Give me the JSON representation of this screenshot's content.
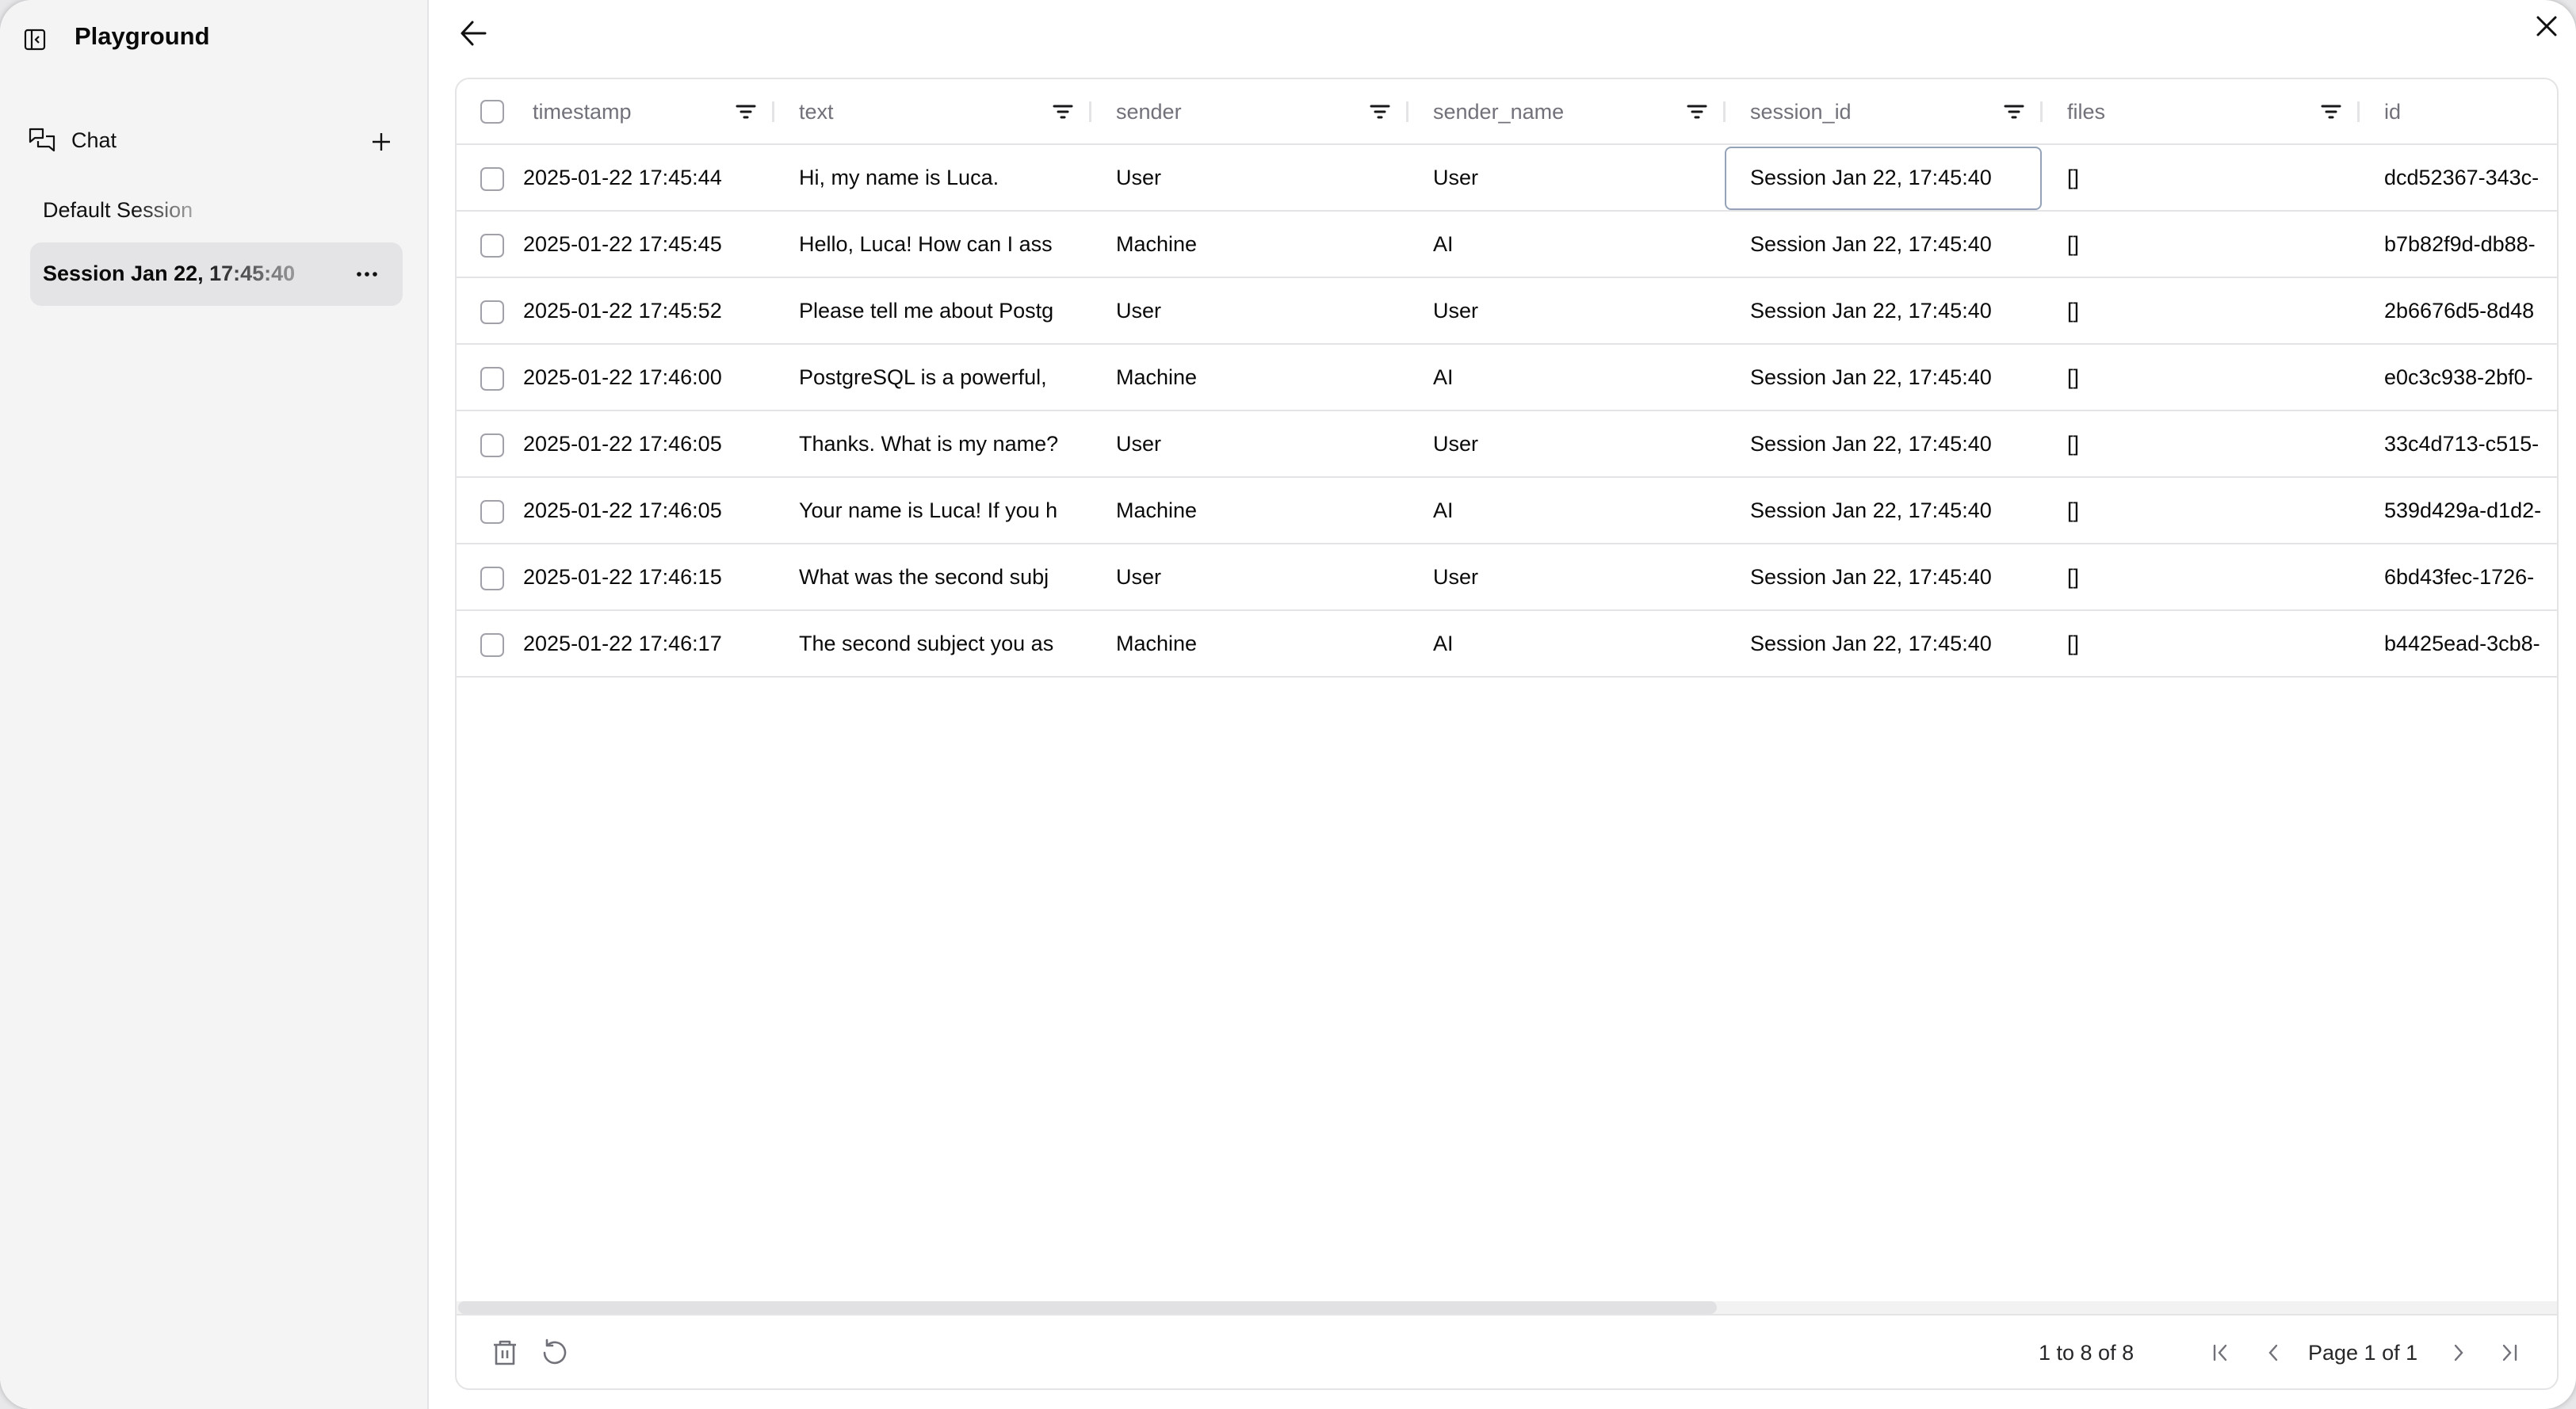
{
  "sidebar": {
    "title": "Playground",
    "section": {
      "label": "Chat"
    },
    "sessions": [
      {
        "label": "Default Session",
        "active": false
      },
      {
        "label": "Session Jan 22, 17:45:40",
        "active": true
      }
    ]
  },
  "table": {
    "columns": [
      {
        "key": "timestamp",
        "label": "timestamp"
      },
      {
        "key": "text",
        "label": "text"
      },
      {
        "key": "sender",
        "label": "sender"
      },
      {
        "key": "sender_name",
        "label": "sender_name"
      },
      {
        "key": "session_id",
        "label": "session_id"
      },
      {
        "key": "files",
        "label": "files"
      },
      {
        "key": "id",
        "label": "id"
      }
    ],
    "rows": [
      {
        "timestamp": "2025-01-22 17:45:44",
        "text": "Hi, my name is Luca.",
        "sender": "User",
        "sender_name": "User",
        "session_id": "Session Jan 22, 17:45:40",
        "files": "[]",
        "id": "dcd52367-343c-"
      },
      {
        "timestamp": "2025-01-22 17:45:45",
        "text": "Hello, Luca! How can I ass",
        "sender": "Machine",
        "sender_name": "AI",
        "session_id": "Session Jan 22, 17:45:40",
        "files": "[]",
        "id": "b7b82f9d-db88-"
      },
      {
        "timestamp": "2025-01-22 17:45:52",
        "text": "Please tell me about Postg",
        "sender": "User",
        "sender_name": "User",
        "session_id": "Session Jan 22, 17:45:40",
        "files": "[]",
        "id": "2b6676d5-8d48"
      },
      {
        "timestamp": "2025-01-22 17:46:00",
        "text": "PostgreSQL is a powerful,",
        "sender": "Machine",
        "sender_name": "AI",
        "session_id": "Session Jan 22, 17:45:40",
        "files": "[]",
        "id": "e0c3c938-2bf0-"
      },
      {
        "timestamp": "2025-01-22 17:46:05",
        "text": "Thanks. What is my name?",
        "sender": "User",
        "sender_name": "User",
        "session_id": "Session Jan 22, 17:45:40",
        "files": "[]",
        "id": "33c4d713-c515-"
      },
      {
        "timestamp": "2025-01-22 17:46:05",
        "text": "Your name is Luca! If you h",
        "sender": "Machine",
        "sender_name": "AI",
        "session_id": "Session Jan 22, 17:45:40",
        "files": "[]",
        "id": "539d429a-d1d2-"
      },
      {
        "timestamp": "2025-01-22 17:46:15",
        "text": "What was the second subj",
        "sender": "User",
        "sender_name": "User",
        "session_id": "Session Jan 22, 17:45:40",
        "files": "[]",
        "id": "6bd43fec-1726-"
      },
      {
        "timestamp": "2025-01-22 17:46:17",
        "text": "The second subject you as",
        "sender": "Machine",
        "sender_name": "AI",
        "session_id": "Session Jan 22, 17:45:40",
        "files": "[]",
        "id": "b4425ead-3cb8-"
      }
    ],
    "focused_cell": {
      "row": 0,
      "column": "session_id"
    },
    "horizontal_scroll_fraction": 0.6
  },
  "footer": {
    "range_text": "1 to 8 of 8",
    "page_text": "Page 1 of 1"
  },
  "icons": {
    "sidebar_toggle": "panel-left-close-icon",
    "chat": "messages-square-icon",
    "add": "plus-icon",
    "more": "ellipsis-icon",
    "back": "arrow-left-icon",
    "close": "x-icon",
    "filter": "list-filter-icon",
    "delete": "trash-icon",
    "refresh": "rotate-ccw-icon",
    "first_page": "chevrons-first-icon",
    "prev_page": "chevron-left-icon",
    "next_page": "chevron-right-icon",
    "last_page": "chevrons-last-icon"
  }
}
